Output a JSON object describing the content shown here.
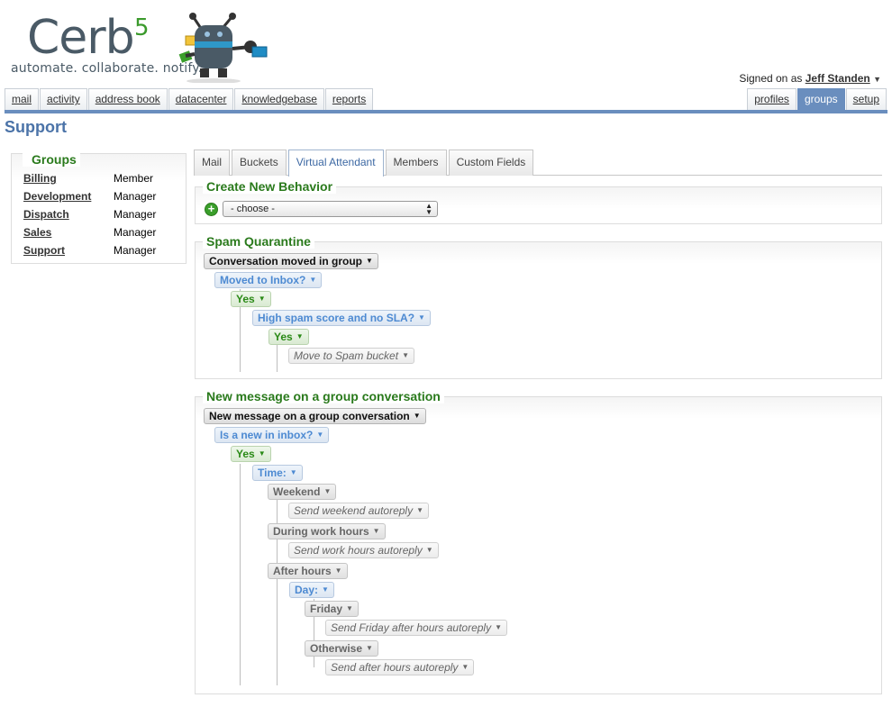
{
  "logo": {
    "word": "Cerb",
    "version": "5",
    "tagline": "automate. collaborate. notify."
  },
  "session": {
    "prefix": "Signed on as",
    "user": "Jeff Standen"
  },
  "nav": {
    "left": [
      "mail",
      "activity",
      "address book",
      "datacenter",
      "knowledgebase",
      "reports"
    ],
    "right": [
      "profiles",
      "groups",
      "setup"
    ],
    "active": "groups"
  },
  "page": {
    "title": "Support"
  },
  "groups": {
    "heading": "Groups",
    "rows": [
      {
        "name": "Billing",
        "role": "Member"
      },
      {
        "name": "Development",
        "role": "Manager"
      },
      {
        "name": "Dispatch",
        "role": "Manager"
      },
      {
        "name": "Sales",
        "role": "Manager"
      },
      {
        "name": "Support",
        "role": "Manager"
      }
    ]
  },
  "tabs": [
    "Mail",
    "Buckets",
    "Virtual Attendant",
    "Members",
    "Custom Fields"
  ],
  "active_tab": "Virtual Attendant",
  "create": {
    "title": "Create New Behavior",
    "select_value": "- choose -"
  },
  "behaviors": [
    {
      "title": "Spam Quarantine",
      "nodes": [
        "Conversation moved in group",
        "Moved to Inbox?",
        "Yes",
        "High spam score and no SLA?",
        "Yes",
        "Move to Spam bucket"
      ]
    },
    {
      "title": "New message on a group conversation",
      "nodes": [
        "New message on a group conversation",
        "Is a new in inbox?",
        "Yes",
        "Time:",
        "Weekend",
        "Send weekend autoreply",
        "During work hours",
        "Send work hours autoreply",
        "After hours",
        "Day:",
        "Friday",
        "Send Friday after hours autoreply",
        "Otherwise",
        "Send after hours autoreply"
      ]
    }
  ],
  "colors": {
    "nav_active": "#6a8ebe",
    "heading_green": "#2a7a1c",
    "switch_blue": "#4d8ad2",
    "yes_green": "#2a8a16"
  }
}
